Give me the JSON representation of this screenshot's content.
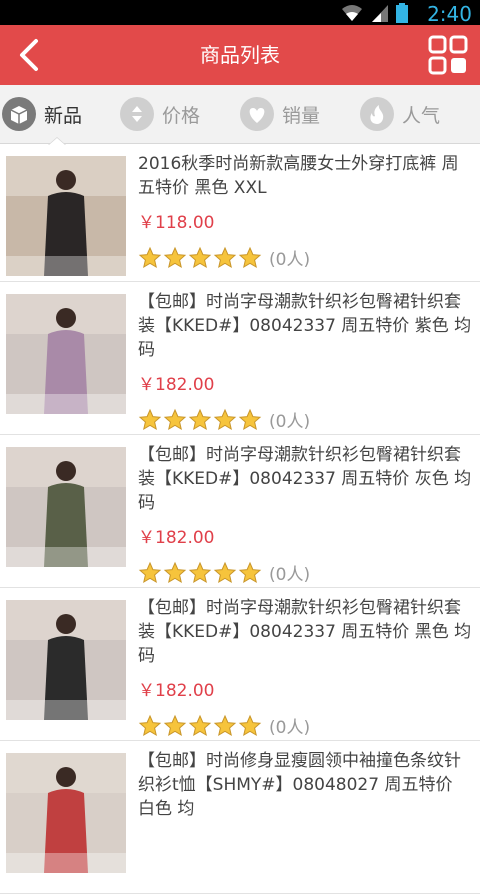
{
  "status": {
    "time": "2:40"
  },
  "header": {
    "title": "商品列表"
  },
  "sort_tabs": [
    {
      "label": "新品",
      "icon": "box-icon",
      "active": true
    },
    {
      "label": "价格",
      "icon": "price-sort-icon",
      "active": false
    },
    {
      "label": "销量",
      "icon": "heart-icon",
      "active": false
    },
    {
      "label": "人气",
      "icon": "flame-icon",
      "active": false
    }
  ],
  "products": [
    {
      "name": "2016秋季时尚新款高腰女士外穿打底裤 周五特价 黑色 XXL",
      "price": "￥118.00",
      "rating_count": "(0人)",
      "photo_colors": [
        "#c8b8a8",
        "#2a2626"
      ]
    },
    {
      "name": "【包邮】时尚字母潮款针织衫包臀裙针织套装【KKED#】08042337 周五特价 紫色 均码",
      "price": "￥182.00",
      "rating_count": "(0人)",
      "photo_colors": [
        "#cfc6c2",
        "#a98aa8"
      ]
    },
    {
      "name": "【包邮】时尚字母潮款针织衫包臀裙针织套装【KKED#】08042337 周五特价 灰色 均码",
      "price": "￥182.00",
      "rating_count": "(0人)",
      "photo_colors": [
        "#cfc6c2",
        "#596048"
      ]
    },
    {
      "name": "【包邮】时尚字母潮款针织衫包臀裙针织套装【KKED#】08042337 周五特价 黑色 均码",
      "price": "￥182.00",
      "rating_count": "(0人)",
      "photo_colors": [
        "#cfc6c2",
        "#2b2b2b"
      ]
    },
    {
      "name": "【包邮】时尚修身显瘦圆领中袖撞色条纹针织衫t恤【SHMY#】08048027 周五特价 白色 均",
      "price": "",
      "rating_count": "",
      "photo_colors": [
        "#d8cfc8",
        "#c04040"
      ]
    }
  ],
  "accent_color": "#e24a4a",
  "price_color": "#e0404a",
  "star_color": "#f6c43c"
}
